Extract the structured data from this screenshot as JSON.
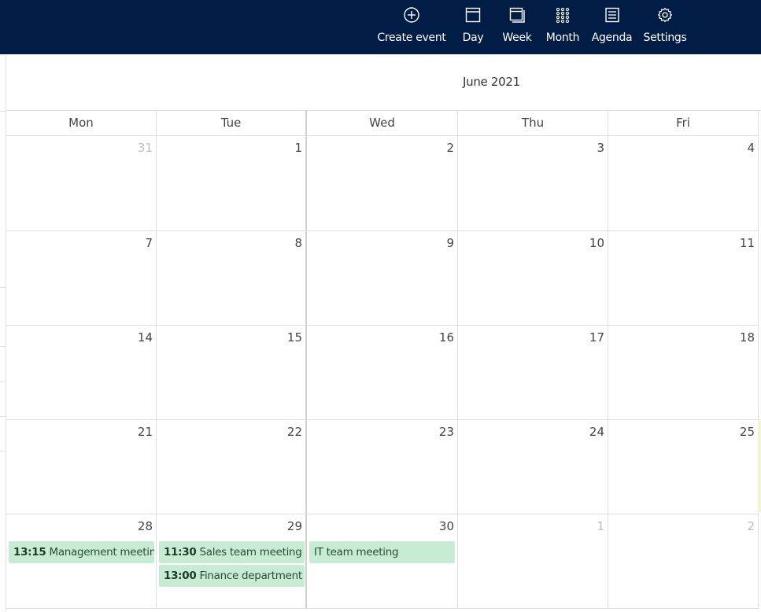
{
  "toolbar": {
    "create_event": "Create event",
    "day": "Day",
    "week": "Week",
    "month": "Month",
    "agenda": "Agenda",
    "settings": "Settings"
  },
  "calendar": {
    "title": "June 2021",
    "weekdays": [
      "Mon",
      "Tue",
      "Wed",
      "Thu",
      "Fri"
    ],
    "weeks": [
      [
        "31",
        "1",
        "2",
        "3",
        "4"
      ],
      [
        "7",
        "8",
        "9",
        "10",
        "11"
      ],
      [
        "14",
        "15",
        "16",
        "17",
        "18"
      ],
      [
        "21",
        "22",
        "23",
        "24",
        "25"
      ],
      [
        "28",
        "29",
        "30",
        "1",
        "2"
      ]
    ],
    "events": {
      "mon28": {
        "time": "13:15",
        "title": "Management meeting"
      },
      "tue29a": {
        "time": "11:30",
        "title": "Sales team meeting"
      },
      "tue29b": {
        "time": "13:00",
        "title": "Finance department t"
      },
      "wed30": {
        "time": "",
        "title": "IT team meeting"
      }
    }
  },
  "colors": {
    "topbar": "#021d45",
    "event_bg": "#c8ecd3"
  }
}
